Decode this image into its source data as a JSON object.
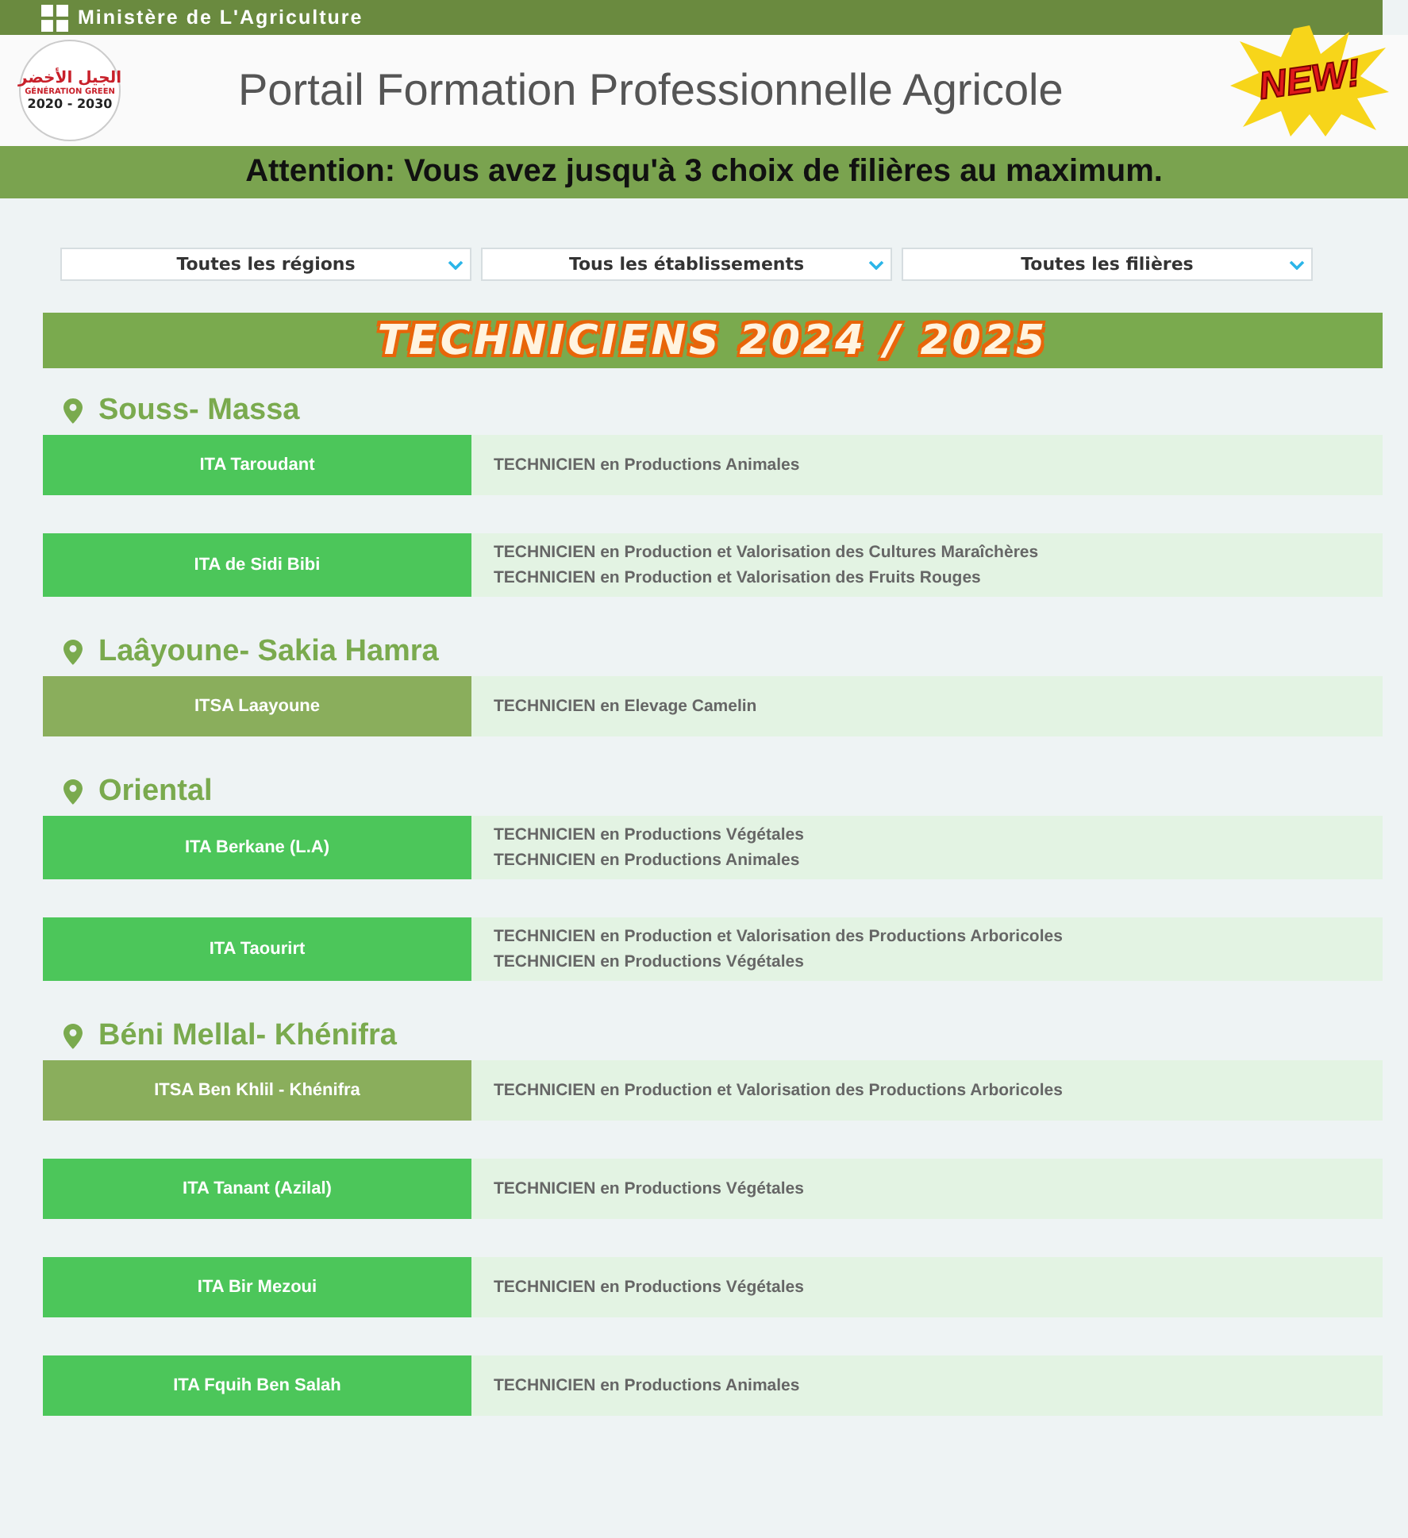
{
  "ministry": "Ministère de L'Agriculture",
  "logo": {
    "arabic": "الجيل الأخضر",
    "line": "GÉNÉRATION GREEN",
    "years": "2020 - 2030"
  },
  "title": "Portail Formation Professionnelle Agricole",
  "badge": "NEW!",
  "notice": "Attention: Vous avez jusqu'à 3 choix de filières au maximum.",
  "filters": [
    {
      "label": "Toutes les régions"
    },
    {
      "label": "Tous les établissements"
    },
    {
      "label": "Toutes les filières"
    }
  ],
  "banner": "TECHNICIENS 2024 / 2025",
  "regions": [
    {
      "name": "Souss- Massa",
      "schools": [
        {
          "name": "ITA Taroudant",
          "color": "#4cc65a",
          "programs": [
            "TECHNICIEN en Productions Animales"
          ]
        },
        {
          "name": "ITA de Sidi Bibi",
          "color": "#4cc65a",
          "programs": [
            "TECHNICIEN en Production et Valorisation des Cultures Maraîchères",
            "TECHNICIEN en Production et Valorisation des Fruits Rouges"
          ]
        }
      ]
    },
    {
      "name": "Laâyoune- Sakia Hamra",
      "schools": [
        {
          "name": "ITSA Laayoune",
          "color": "#8aae5c",
          "programs": [
            "TECHNICIEN en Elevage Camelin"
          ]
        }
      ]
    },
    {
      "name": "Oriental",
      "schools": [
        {
          "name": "ITA Berkane (L.A)",
          "color": "#4cc65a",
          "programs": [
            "TECHNICIEN en Productions Végétales",
            "TECHNICIEN en Productions Animales"
          ]
        },
        {
          "name": "ITA Taourirt",
          "color": "#4cc65a",
          "programs": [
            "TECHNICIEN en Production et Valorisation des Productions Arboricoles",
            "TECHNICIEN en Productions Végétales"
          ]
        }
      ]
    },
    {
      "name": "Béni Mellal- Khénifra",
      "schools": [
        {
          "name": "ITSA Ben Khlil - Khénifra",
          "color": "#8aae5c",
          "programs": [
            "TECHNICIEN en Production et Valorisation des Productions Arboricoles"
          ]
        },
        {
          "name": "ITA Tanant (Azilal)",
          "color": "#4cc65a",
          "programs": [
            "TECHNICIEN en Productions Végétales"
          ]
        },
        {
          "name": "ITA Bir Mezoui",
          "color": "#4cc65a",
          "programs": [
            "TECHNICIEN en Productions Végétales"
          ]
        },
        {
          "name": "ITA Fquih Ben Salah",
          "color": "#4cc65a",
          "programs": [
            "TECHNICIEN en Productions Animales"
          ]
        }
      ]
    }
  ]
}
